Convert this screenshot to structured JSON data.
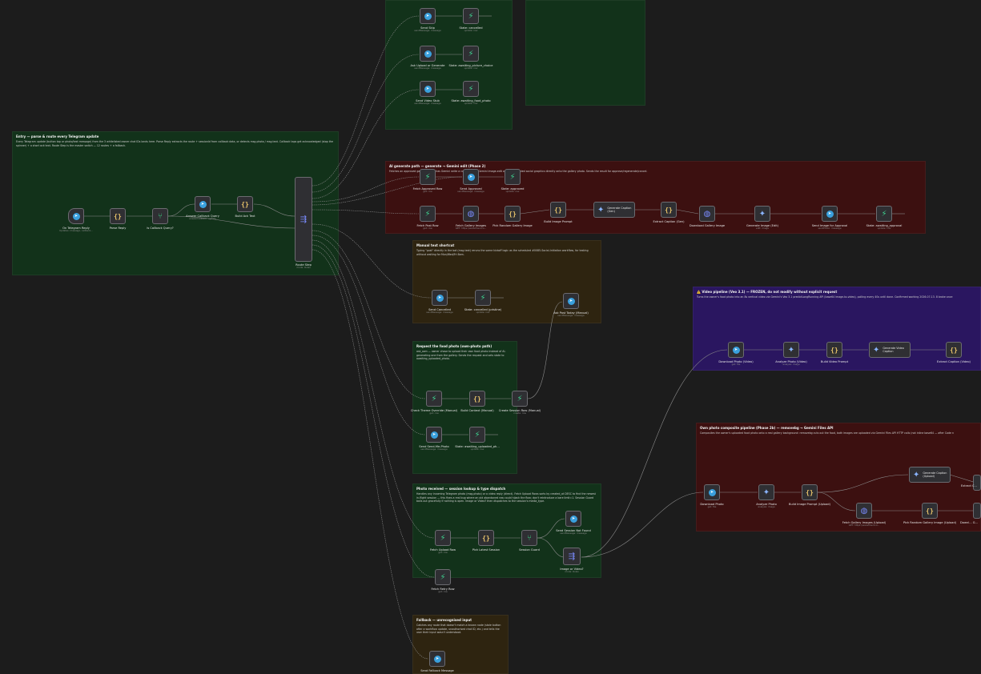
{
  "stickies": [
    {
      "id": "top-green",
      "title": "",
      "body": "",
      "color": "#12321a"
    },
    {
      "id": "top-green-2",
      "title": "",
      "body": "",
      "color": "#12321a"
    },
    {
      "id": "entry",
      "title": "Entry — parse & route every Telegram update",
      "body": "Every Telegram update (button tap or photo/text message) from the 3 whitelisted owner chat IDs lands here. Parse Reply extracts the route + sessionId from callback data, or detects msg.photo / msg.text. Callback taps get acknowledged (stop the spinner) + a short ack text. Route Step is the master switch — 12 routes + a fallback.",
      "color": "#12321a"
    },
    {
      "id": "ai-generate",
      "title": "AI generate path — generate → Gemini edit (Phase 2)",
      "body": "Fetches an approved gallery image, has Gemini write a caption, then Gemini image-edit overlays branded social graphics directly onto the gallery photo. Sends the result for approve/regenerate/cancel.",
      "color": "#3c1010"
    },
    {
      "id": "manual-shortcut",
      "title": "Manual text shortcut",
      "body": "Typing \"post\" directly in the bot (msg.text) reruns the same kickoff logic as the scheduled #0085-Social-Initiation workflow, for testing without waiting for Mon/Wed/Fri 8am.",
      "color": "#2e2410"
    },
    {
      "id": "request-food",
      "title": "Request the food photo (own-photo path)",
      "body": "ask_own — owner chose to upload their own food photo instead of AI-generating one from the gallery. Sends the request and sets state to awaiting_uploaded_photo.",
      "color": "#12321a"
    },
    {
      "id": "photo-received",
      "title": "Photo received — session lookup & type dispatch",
      "body": "Handles any incoming Telegram photo (msg.photo) or a video reply (direct). Fetch Upload Rows sorts by created_at DESC to find the newest in-flight session — this fixes a real bug where an old abandoned row could hijack the flow; don't reintroduce a bare limit=1. Session Guard bails out gracefully if nothing is open. Image or Video? then dispatches to the session's media_type.",
      "color": "#12321a"
    },
    {
      "id": "fallback",
      "title": "Fallback — unrecognised input",
      "body": "Catches any route that doesn't match a known node (stale button after a workflow update, unauthorised chat ID, etc.) and tells the user their input wasn't understood.",
      "color": "#2e2410"
    },
    {
      "id": "video-pipeline",
      "title": "⚠️ Video pipeline (Veo 3.1) — FROZEN, do not modify without explicit request",
      "body": "Turns the owner's food photo into an 8s vertical video via Gemini's Veo 3.1 predictLongRunning API (base64 image-to-video), polling every 40s until done. Confirmed working 2026-07-13. 8 broke once",
      "color": "#2a1660"
    },
    {
      "id": "own-photo",
      "title": "Own photo composite pipeline (Phase 2b) — removebg → Gemini Files API",
      "body": "Composites the owner's uploaded food photo onto a real gallery background: removebg cuts out the food, both images are uploaded via Gemini Files API HTTP calls (not inline base64 — after Code n",
      "color": "#3c1010"
    }
  ],
  "nodes": {
    "on_telegram_reply": {
      "label": "On Telegram Reply",
      "sub": "Updates: message, callback...",
      "icon": "telegram-icon"
    },
    "parse_reply": {
      "label": "Parse Reply",
      "sub": "",
      "icon": "code-icon"
    },
    "is_callback_query": {
      "label": "Is Callback Query?",
      "sub": "",
      "icon": "if-icon"
    },
    "answer_callback_query": {
      "label": "Answer Callback Query",
      "sub": "answerCallback: update",
      "icon": "telegram-icon"
    },
    "build_ack_text": {
      "label": "Build Ack Text",
      "sub": "",
      "icon": "code-icon"
    },
    "route_step": {
      "label": "Route Step",
      "sub": "mode: Rules",
      "icon": "switch-icon"
    },
    "send_skip": {
      "label": "Send Skip",
      "sub": "sendMessage: message",
      "icon": "telegram-icon"
    },
    "state_cancelled": {
      "label": "State: cancelled",
      "sub": "update: row",
      "icon": "supabase-icon"
    },
    "ask_upload_or_generate": {
      "label": "Ask Upload or Generate",
      "sub": "sendMessage: message",
      "icon": "telegram-icon"
    },
    "state_awaiting_picture_choice": {
      "label": "State: awaiting_picture_choice",
      "sub": "update: row",
      "icon": "supabase-icon"
    },
    "send_video_stub": {
      "label": "Send Video Stub",
      "sub": "sendMessage: message",
      "icon": "telegram-icon"
    },
    "state_awaiting_food_photo": {
      "label": "State: awaiting_food_photo",
      "sub": "update: row",
      "icon": "supabase-icon"
    },
    "fetch_approved_row": {
      "label": "Fetch Approved Row",
      "sub": "get: row",
      "icon": "supabase-icon"
    },
    "send_approved": {
      "label": "Send Approved",
      "sub": "sendMessage: message",
      "icon": "telegram-icon"
    },
    "state_approved": {
      "label": "State: approved",
      "sub": "update: row",
      "icon": "supabase-icon"
    },
    "fetch_post_row": {
      "label": "Fetch Post Row",
      "sub": "get: row",
      "icon": "supabase-icon"
    },
    "fetch_gallery_images": {
      "label": "Fetch Gallery Images",
      "sub": "GET: https://www.thecoco...",
      "icon": "http-icon"
    },
    "pick_random_gallery_image": {
      "label": "Pick Random Gallery Image",
      "sub": "",
      "icon": "code-icon"
    },
    "build_image_prompt": {
      "label": "Build Image Prompt",
      "sub": "",
      "icon": "code-icon"
    },
    "generate_caption_gen": {
      "label": "Generate Caption (Gen)",
      "sub": "message: text",
      "icon": "gemini-icon"
    },
    "extract_caption_gen": {
      "label": "Extract Caption (Gen)",
      "sub": "",
      "icon": "code-icon"
    },
    "download_gallery_image": {
      "label": "Download Gallery Image",
      "sub": "",
      "icon": "http-icon"
    },
    "generate_image_edit": {
      "label": "Generate Image (Edit)",
      "sub": "edit: image",
      "icon": "gemini-icon"
    },
    "send_image_for_approval": {
      "label": "Send Image for Approval",
      "sub": "sendPhoto: message",
      "icon": "telegram-icon"
    },
    "state_awaiting_approval": {
      "label": "State: awaiting_approval",
      "sub": "update: row",
      "icon": "supabase-icon"
    },
    "send_cancelled": {
      "label": "Send Cancelled",
      "sub": "sendMessage: message",
      "icon": "telegram-icon"
    },
    "state_cancelled_pristine": {
      "label": "State: cancelled (pristine)",
      "sub": "update: row",
      "icon": "supabase-icon"
    },
    "ask_post_today_manual": {
      "label": "Ask Post Today (Manual)",
      "sub": "sendMessage: message",
      "icon": "telegram-icon"
    },
    "check_theme_override": {
      "label": "Check Theme Override (Manual)",
      "sub": "get: row",
      "icon": "supabase-icon"
    },
    "build_context_manual": {
      "label": "Build Context (Manual)",
      "sub": "",
      "icon": "code-icon"
    },
    "create_session_row_manual": {
      "label": "Create Session Row (Manual)",
      "sub": "create: row",
      "icon": "supabase-icon"
    },
    "send_send_me_photo": {
      "label": "Send Send-Me-Photo",
      "sub": "sendMessage: message",
      "icon": "telegram-icon"
    },
    "state_awaiting_uploaded_ph": {
      "label": "State: awaiting_uploaded_ph...",
      "sub": "update: row",
      "icon": "supabase-icon"
    },
    "send_session_not_found": {
      "label": "Send Session Not Found",
      "sub": "sendMessage: message",
      "icon": "telegram-icon"
    },
    "fetch_upload_row": {
      "label": "Fetch Upload Row",
      "sub": "get: row",
      "icon": "supabase-icon"
    },
    "pick_latest_session": {
      "label": "Pick Latest Session",
      "sub": "",
      "icon": "code-icon"
    },
    "session_guard": {
      "label": "Session Guard",
      "sub": "",
      "icon": "if-icon"
    },
    "image_or_video": {
      "label": "Image or Video?",
      "sub": "mode: Rules",
      "icon": "switch-icon"
    },
    "fetch_retry_row": {
      "label": "Fetch Retry Row",
      "sub": "get: row",
      "icon": "supabase-icon"
    },
    "send_fallback_message": {
      "label": "Send Fallback Message",
      "sub": "",
      "icon": "telegram-icon"
    },
    "download_photo_video": {
      "label": "Download Photo (Video)",
      "sub": "get: file",
      "icon": "telegram-icon"
    },
    "analyze_photo_video": {
      "label": "Analyze Photo (Video)",
      "sub": "analyze: image",
      "icon": "gemini-icon"
    },
    "build_video_prompt": {
      "label": "Build Video Prompt",
      "sub": "",
      "icon": "code-icon"
    },
    "generate_video_caption": {
      "label": "Generate Video Caption",
      "sub": "message: text",
      "icon": "gemini-icon"
    },
    "extract_caption_video": {
      "label": "Extract Caption (Video)",
      "sub": "",
      "icon": "code-icon"
    },
    "download_photo": {
      "label": "Download Photo",
      "sub": "get: file",
      "icon": "telegram-icon"
    },
    "analyze_photo": {
      "label": "Analyze Photo",
      "sub": "analyze: image",
      "icon": "gemini-icon"
    },
    "build_image_prompt_upload": {
      "label": "Build Image Prompt (Upload)",
      "sub": "",
      "icon": "code-icon"
    },
    "generate_caption_upload": {
      "label": "Generate Caption (Upload)",
      "sub": "message: text",
      "icon": "gemini-icon"
    },
    "fetch_gallery_images_upload": {
      "label": "Fetch Gallery Images (Upload)",
      "sub": "GET: https://www.thecoco...",
      "icon": "http-icon"
    },
    "pick_random_gallery_image_upload": {
      "label": "Pick Random Gallery Image (Upload)",
      "sub": "",
      "icon": "code-icon"
    },
    "extract_caption_upload": {
      "label": "Extract C...",
      "sub": "",
      "icon": "code-icon"
    },
    "download_upload": {
      "label": "Downl... G...",
      "sub": "",
      "icon": "http-icon"
    }
  },
  "colors": {
    "edge": "#8a8a8a",
    "green_sticky": "#12321a",
    "red_sticky": "#3c1010",
    "brown_sticky": "#2e2410",
    "purple_sticky": "#2a1660",
    "canvas": "#1c1c1c"
  }
}
